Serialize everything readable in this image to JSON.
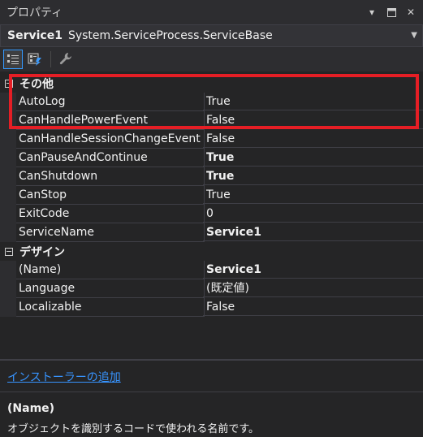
{
  "window": {
    "title": "プロパティ"
  },
  "object_selector": {
    "name": "Service1",
    "type": "System.ServiceProcess.ServiceBase"
  },
  "toolbar": {
    "buttons": [
      {
        "icon": "categorized-icon",
        "active": true
      },
      {
        "icon": "events-icon",
        "active": false
      },
      {
        "icon": "wrench-icon",
        "active": false
      }
    ]
  },
  "categories": [
    {
      "label": "その他",
      "rows": [
        {
          "name": "AutoLog",
          "value": "True",
          "bold": false
        },
        {
          "name": "CanHandlePowerEvent",
          "value": "False",
          "bold": false
        },
        {
          "name": "CanHandleSessionChangeEvent",
          "value": "False",
          "bold": false
        },
        {
          "name": "CanPauseAndContinue",
          "value": "True",
          "bold": true
        },
        {
          "name": "CanShutdown",
          "value": "True",
          "bold": true
        },
        {
          "name": "CanStop",
          "value": "True",
          "bold": false
        },
        {
          "name": "ExitCode",
          "value": "0",
          "bold": false
        },
        {
          "name": "ServiceName",
          "value": "Service1",
          "bold": true
        }
      ]
    },
    {
      "label": "デザイン",
      "rows": [
        {
          "name": "(Name)",
          "value": "Service1",
          "bold": true
        },
        {
          "name": "Language",
          "value": "(既定値)",
          "bold": false
        },
        {
          "name": "Localizable",
          "value": "False",
          "bold": false
        }
      ]
    }
  ],
  "commands": {
    "link": "インストーラーの追加"
  },
  "description": {
    "title": "(Name)",
    "text": "オブジェクトを識別するコードで使われる名前です。"
  },
  "colors": {
    "highlight_box": "#e51e25",
    "link": "#3794ff",
    "background": "#252526"
  }
}
